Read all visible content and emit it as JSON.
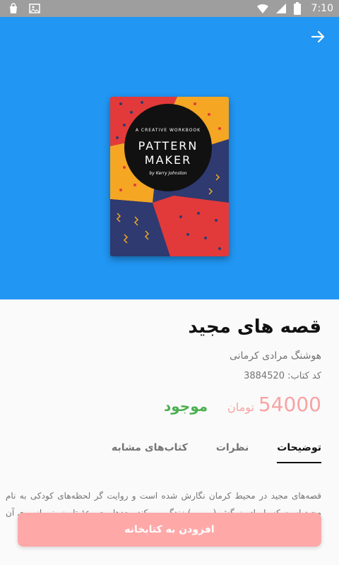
{
  "status_bar": {
    "time": "7:10",
    "left_icons": [
      "bag-icon",
      "image-icon"
    ],
    "right_icons": [
      "wifi-icon",
      "cellular-icon",
      "battery-icon"
    ]
  },
  "header": {
    "nav_icon": "arrow-forward-icon",
    "background_color": "#2196f3"
  },
  "cover": {
    "subtitle": "A CREATIVE WORKBOOK",
    "title_line1": "PATTERN",
    "title_line2": "MAKER",
    "author": "by Kerry Johnston"
  },
  "book": {
    "title": "قصه های مجید",
    "author": "هوشنگ مرادی کرمانی",
    "code_label": "کد کتاب:",
    "code_value": "3884520",
    "price": "54000",
    "currency": "تومان",
    "availability": "موجود"
  },
  "tabs": [
    {
      "label": "توضیحات",
      "active": true
    },
    {
      "label": "نظرات",
      "active": false
    },
    {
      "label": "کتاب‌های مشابه",
      "active": false
    }
  ],
  "description": "قصه‌های مجید در محیط کرمان نگارش شده است و روایت گر لحظه‌های کودکی به نام مجید است که با مادربزرگش (بی بی) زندگی می‌کند. بعدها مجموعهٔ تلویزیونی از روی آن ساخته شد.",
  "add_button": {
    "label": "افزودن به کتابخانه",
    "color": "#ffa8a8"
  },
  "colors": {
    "accent": "#2196f3",
    "price": "#f8a3a3",
    "in_stock": "#4caf50"
  }
}
